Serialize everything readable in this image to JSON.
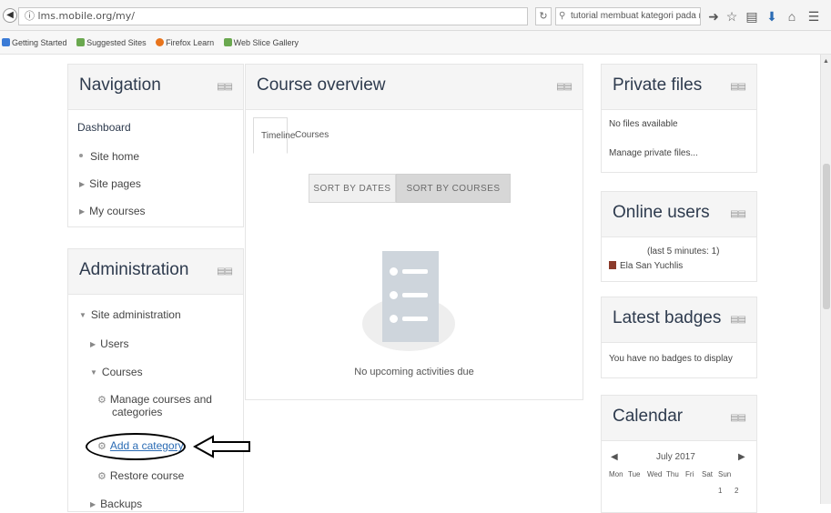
{
  "browser": {
    "url": "lms.mobile.org/my/",
    "search_text": "tutorial membuat kategori pada moodle",
    "bookmarks": [
      "Getting Started",
      "Suggested Sites",
      "Firefox Learn",
      "Web Slice Gallery"
    ]
  },
  "navigation": {
    "title": "Navigation",
    "dashboard": "Dashboard",
    "items": [
      "Site home",
      "Site pages",
      "My courses"
    ]
  },
  "administration": {
    "title": "Administration",
    "site_admin": "Site administration",
    "users": "Users",
    "courses": "Courses",
    "manage_courses_line1": "Manage courses and",
    "manage_courses_line2": "categories",
    "add_category": "Add a category",
    "restore_course": "Restore course",
    "backups": "Backups"
  },
  "course_overview": {
    "title": "Course overview",
    "tabs": [
      "Timeline",
      "Courses"
    ],
    "sort_by_dates": "SORT BY DATES",
    "sort_by_courses": "SORT BY COURSES",
    "empty_message": "No upcoming activities due"
  },
  "private_files": {
    "title": "Private files",
    "no_files": "No files available",
    "manage_link": "Manage private files..."
  },
  "online_users": {
    "title": "Online users",
    "last_minutes": "(last 5 minutes: 1)",
    "user_name": "Ela San Yuchlis"
  },
  "latest_badges": {
    "title": "Latest badges",
    "message": "You have no badges to display"
  },
  "calendar": {
    "title": "Calendar",
    "month": "July 2017",
    "weekdays": [
      "Mon",
      "Tue",
      "Wed",
      "Thu",
      "Fri",
      "Sat",
      "Sun"
    ],
    "first_row": [
      "1",
      "2"
    ]
  }
}
